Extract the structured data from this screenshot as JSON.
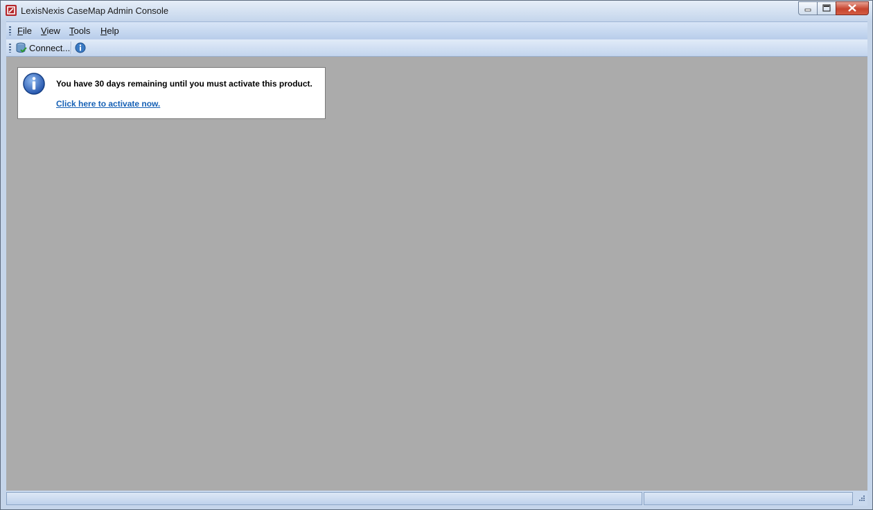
{
  "window": {
    "title": "LexisNexis CaseMap Admin Console"
  },
  "menu": {
    "items": [
      "File",
      "View",
      "Tools",
      "Help"
    ]
  },
  "toolbar": {
    "connect_label": "Connect...",
    "connect_icon": "database-connect-icon",
    "info_icon": "info-icon"
  },
  "notice": {
    "message": "You have 30 days remaining until you must activate this product.",
    "link": "Click here to activate now.",
    "icon": "info-icon"
  },
  "colors": {
    "client_bg": "#ababab",
    "link": "#1560b5",
    "close_button": "#c7452f"
  }
}
